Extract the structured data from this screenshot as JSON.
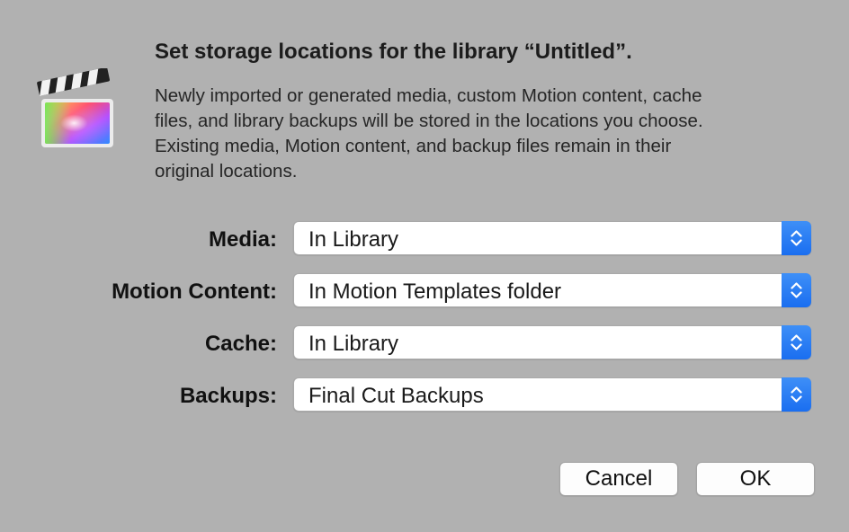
{
  "dialog": {
    "title": "Set storage locations for the library “Untitled”.",
    "message_lines": [
      "Newly imported or generated media, custom Motion content, cache",
      "files, and library backups will be stored in the locations you choose.",
      "Existing media, Motion content, and backup files remain in their",
      "original locations."
    ],
    "app_icon": "final-cut-pro-clapperboard-icon"
  },
  "fields": [
    {
      "label": "Media:",
      "value": "In Library"
    },
    {
      "label": "Motion Content:",
      "value": "In Motion Templates folder"
    },
    {
      "label": "Cache:",
      "value": "In Library"
    },
    {
      "label": "Backups:",
      "value": "Final Cut Backups"
    }
  ],
  "buttons": {
    "cancel": "Cancel",
    "ok": "OK"
  },
  "colors": {
    "background": "#b1b1b1",
    "stepper_accent": "#1a6ef0"
  }
}
